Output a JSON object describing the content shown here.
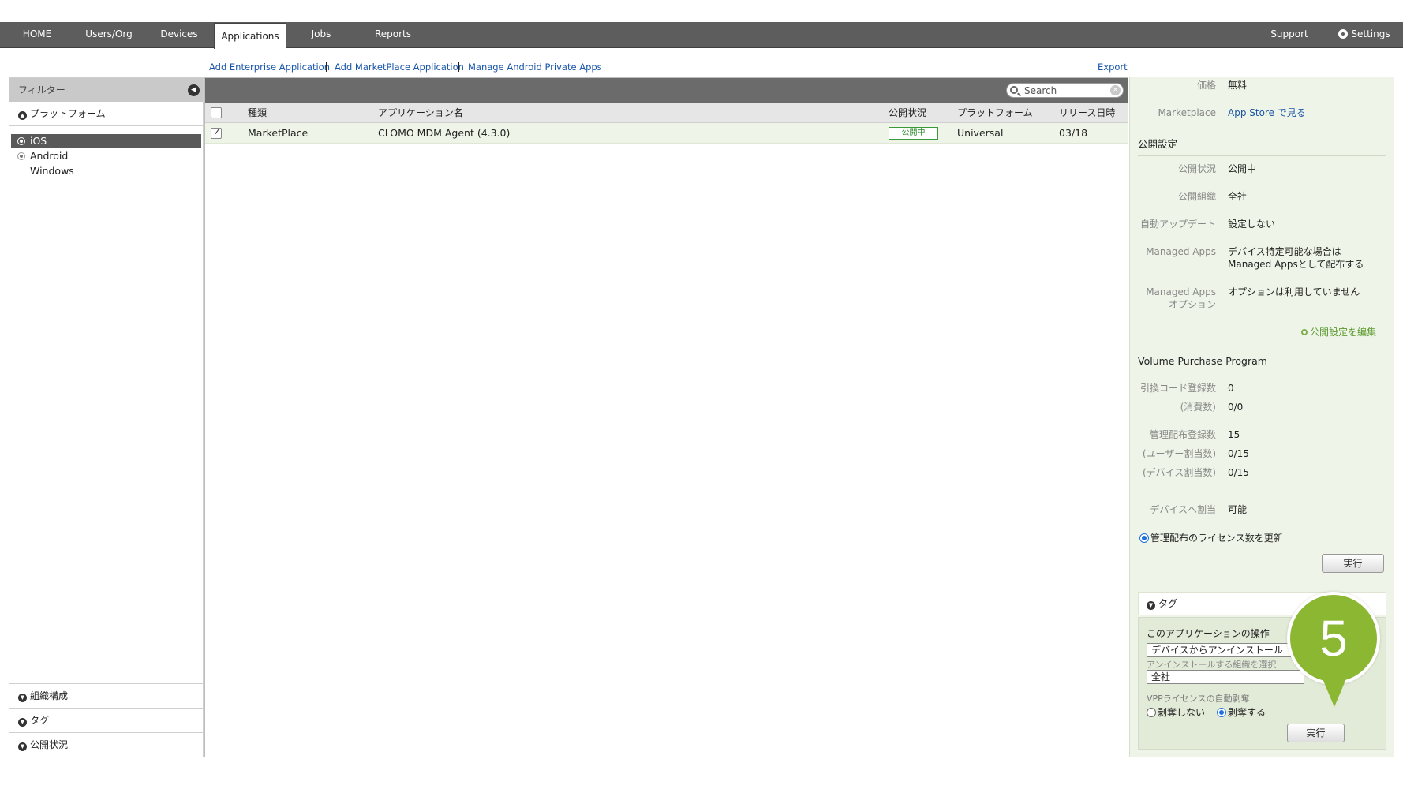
{
  "nav": {
    "items": [
      "HOME",
      "Users/Org",
      "Devices",
      "Applications",
      "Jobs",
      "Reports"
    ],
    "support": "Support",
    "settings": "Settings"
  },
  "actions": {
    "add_enterprise": "Add Enterprise Application",
    "add_marketplace": "Add MarketPlace Application",
    "manage_android": "Manage Android Private Apps",
    "export": "Export"
  },
  "filter": {
    "title": "フィルター",
    "platform_section": "プラットフォーム",
    "platforms": [
      "iOS",
      "Android",
      "Windows"
    ],
    "selected_platform": "iOS",
    "bottom_sections": [
      "組織構成",
      "タグ",
      "公開状況"
    ]
  },
  "table": {
    "search_placeholder": "Search",
    "headers": [
      "種類",
      "アプリケーション名",
      "公開状況",
      "プラットフォーム",
      "リリース日時"
    ],
    "rows": [
      {
        "type": "MarketPlace",
        "name": "CLOMO MDM Agent (4.3.0)",
        "status": "公開中",
        "platform": "Universal",
        "release": "03/18"
      }
    ]
  },
  "detail": {
    "price_label": "価格",
    "price_value": "無料",
    "marketplace_label": "Marketplace",
    "marketplace_value": "App Store で見る",
    "publish_section": "公開設定",
    "publish_status_label": "公開状況",
    "publish_status_value": "公開中",
    "publish_org_label": "公開組織",
    "publish_org_value": "全社",
    "auto_update_label": "自動アップデート",
    "auto_update_value": "設定しない",
    "managed_apps_label": "Managed Apps",
    "managed_apps_value_1": "デバイス特定可能な場合は",
    "managed_apps_value_2": "Managed Appsとして配布する",
    "managed_opt_label_1": "Managed Apps",
    "managed_opt_label_2": "オプション",
    "managed_opt_value": "オプションは利用していません",
    "edit_publish": "公開設定を編集",
    "vpp_section": "Volume Purchase Program",
    "redeem_label": "引換コード登録数",
    "redeem_value": "0",
    "consumed_label": "(消費数)",
    "consumed_value": "0/0",
    "managed_count_label": "管理配布登録数",
    "managed_count_value": "15",
    "user_assign_label": "(ユーザー割当数)",
    "user_assign_value": "0/15",
    "device_assign_label": "(デバイス割当数)",
    "device_assign_value": "0/15",
    "device_alloc_label": "デバイスへ割当",
    "device_alloc_value": "可能",
    "update_license": "管理配布のライセンス数を更新",
    "run": "実行",
    "tag_section": "タグ",
    "operation_title": "このアプリケーションの操作",
    "operation_select": "デバイスからアンインストール",
    "uninstall_org_label": "アンインストールする組織を選択",
    "org_select": "全社",
    "vpp_revoke_label": "VPPライセンスの自動剥奪",
    "no_revoke": "剥奪しない",
    "revoke": "剥奪する",
    "run2": "実行"
  },
  "marker": {
    "number": "5"
  },
  "colors": {
    "nav_bg": "#5d5d5d",
    "link": "#1a56a8",
    "panel_bg": "#eef4e7",
    "status_green": "#3a9a3a",
    "marker": "#8bb733"
  }
}
